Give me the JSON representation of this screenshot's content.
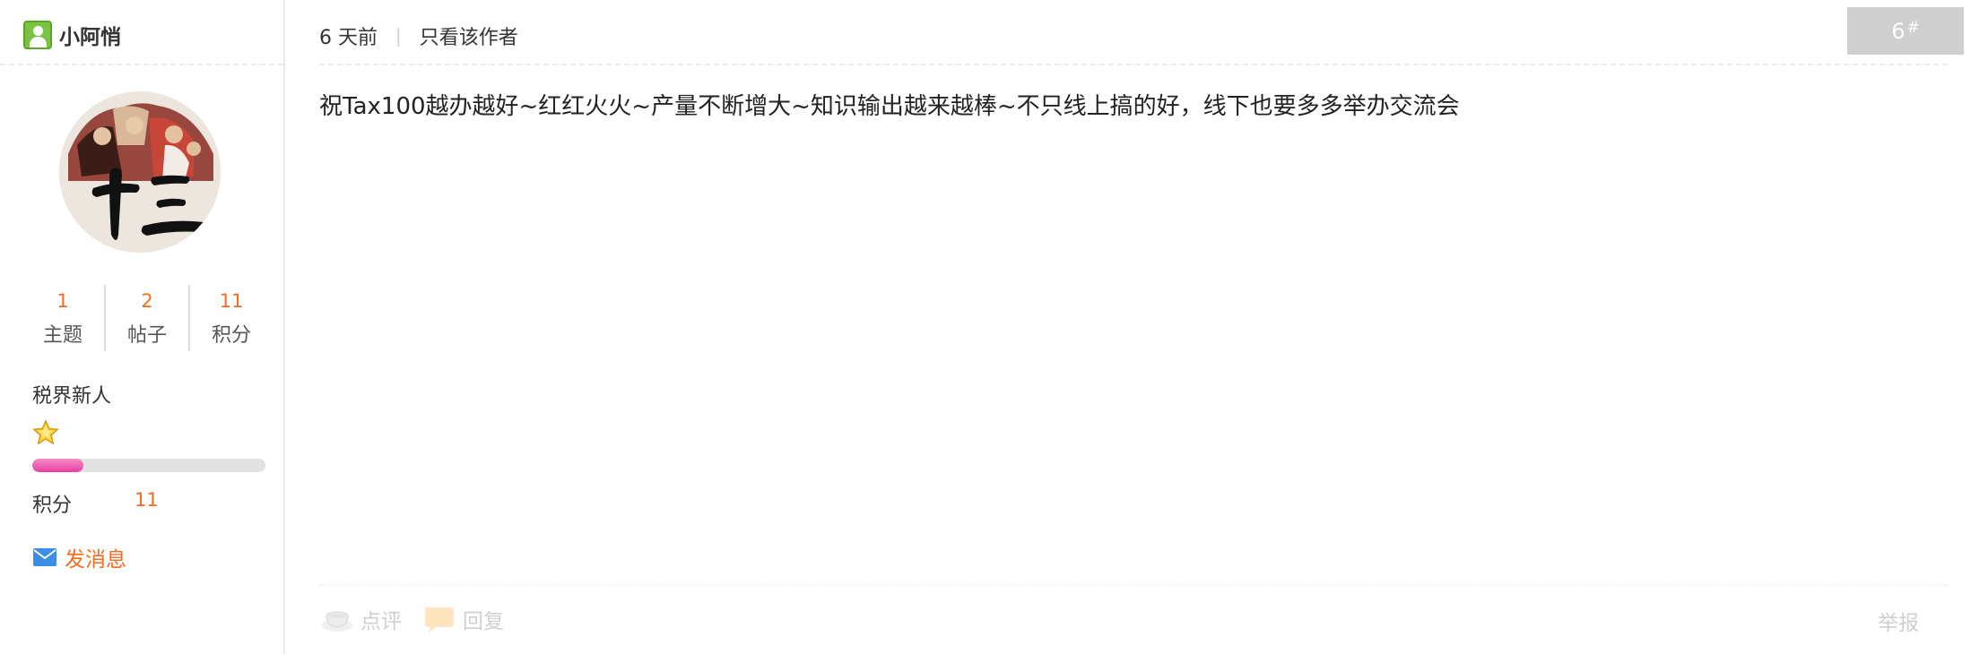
{
  "user": {
    "name": "小阿悄",
    "avatar_text": "十三",
    "stats": [
      {
        "value": "1",
        "label": "主题"
      },
      {
        "value": "2",
        "label": "帖子"
      },
      {
        "value": "11",
        "label": "积分"
      }
    ],
    "rank": "税界新人",
    "level_progress": 0.22,
    "credit_label": "积分",
    "credit_value": "11",
    "send_message": "发消息"
  },
  "post": {
    "time": "6 天前",
    "separator": "|",
    "author_only": "只看该作者",
    "floor": "6",
    "floor_suffix": "#",
    "content": "祝Tax100越办越好~红红火火~产量不断增大~知识输出越来越棒~不只线上搞的好，线下也要多多举办交流会"
  },
  "actions": {
    "comment": "点评",
    "reply": "回复",
    "report": "举报"
  },
  "icons": {
    "user": "user-icon",
    "level": "star-icon",
    "message": "mail-icon",
    "comment": "cup-icon",
    "reply": "speech-bubble-icon"
  },
  "colors": {
    "accent": "#f26c22",
    "progress": "#e83fa0",
    "user_icon": "#7cc243",
    "floor_badge": "#cfcfcf"
  }
}
